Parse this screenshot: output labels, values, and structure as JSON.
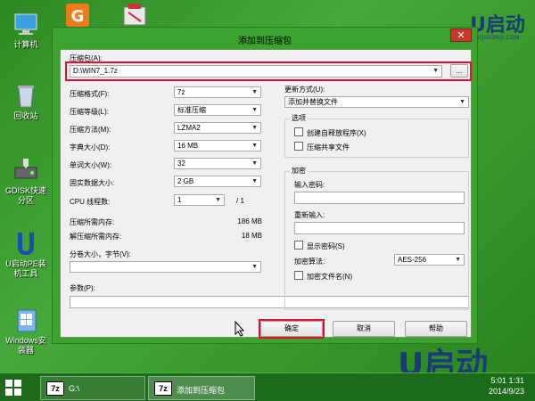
{
  "desktop": {
    "icons": [
      {
        "label": "计算机"
      },
      {
        "label": "回收站"
      },
      {
        "label": "GDISK快速分区"
      },
      {
        "label": "U启动PE装机工具"
      },
      {
        "label": "Windows安装器"
      }
    ],
    "brand_top": "U启动",
    "brand_url": "UQIDONG.COM",
    "brand_bottom": "U启动"
  },
  "dialog": {
    "title": "添加到压缩包",
    "close": "✕",
    "archive_label": "压缩包(A):",
    "archive_value": "D:\\WIN7_1.7z",
    "browse": "...",
    "format_label": "压缩格式(F):",
    "format_value": "7z",
    "level_label": "压缩等级(L):",
    "level_value": "标准压缩",
    "method_label": "压缩方法(M):",
    "method_value": "LZMA2",
    "dict_label": "字典大小(D):",
    "dict_value": "16 MB",
    "word_label": "单词大小(W):",
    "word_value": "32",
    "solid_label": "固实数据大小:",
    "solid_value": "2 GB",
    "cpu_label": "CPU 线程数:",
    "cpu_value": "1",
    "cpu_total": "/ 1",
    "mem_comp_label": "压缩所需内存:",
    "mem_comp_value": "186 MB",
    "mem_decomp_label": "解压缩所需内存:",
    "mem_decomp_value": "18 MB",
    "split_label": "分卷大小，字节(V):",
    "split_value": "",
    "params_label": "参数(P):",
    "params_value": "",
    "update_label": "更新方式(U):",
    "update_value": "添加并替换文件",
    "options_title": "选项",
    "opt_sfx": "创建自释放程序(X)",
    "opt_shared": "压缩共享文件",
    "encrypt_title": "加密",
    "pwd_label": "输入密码:",
    "pwd_confirm_label": "重新输入:",
    "show_pwd": "显示密码(S)",
    "enc_method_label": "加密算法:",
    "enc_method_value": "AES-256",
    "enc_names": "加密文件名(N)",
    "ok": "确定",
    "cancel": "取消",
    "help": "帮助"
  },
  "taskbar": {
    "tasks": [
      {
        "icon": "7z",
        "label": "G:\\"
      },
      {
        "icon": "7z",
        "label": "添加到压缩包"
      }
    ],
    "time": "5:01 1:31",
    "date": "2014/9/23"
  }
}
